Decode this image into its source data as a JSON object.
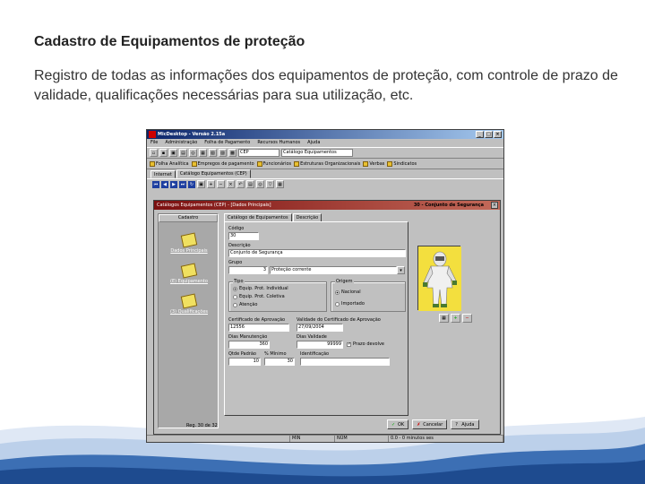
{
  "slide": {
    "title": "Cadastro de Equipamentos de proteção",
    "body": "Registro de todas as informações dos equipamentos de proteção, com controle de prazo de validade, qualificações necessárias para sua utilização, etc."
  },
  "window": {
    "title": "MicDesktop - Versão 2.15a",
    "menu": [
      "File",
      "Administração",
      "Folha de Pagamento",
      "Recursos Humanos",
      "Ajuda"
    ],
    "search_code": "CEP",
    "search_name": "Catálogo Equipamentos",
    "shortcuts": [
      "Folha Analítica",
      "Empregos de pagamento",
      "Funcionários",
      "Estruturas Organizacionais",
      "Verbas",
      "Sindicatos"
    ],
    "doc_tabs": [
      "Internet",
      "Catálogo Equipamentos (CEP)"
    ]
  },
  "child": {
    "title": "Catálogos Equipamentos (CEP) - [Dados Principais]",
    "record_title": "30 - Conjunto de Segurança",
    "left_panel_header": "Cadastro",
    "left_items": [
      "Dados Principais",
      "(E) Equipamento",
      "(3) Qualificações"
    ],
    "tabs": [
      "Catálogo de Equipamentos",
      "Descrição"
    ],
    "fields": {
      "codigo_label": "Código",
      "codigo_value": "30",
      "descricao_label": "Descrição",
      "descricao_value": "Conjunto de Segurança",
      "grupo_label": "Grupo",
      "grupo_num": "3",
      "grupo_value": "Proteção corrente",
      "tipo_label": "Tipo",
      "tipo_options": [
        "Equip. Prot. Individual",
        "Equip. Prot. Coletiva",
        "Atenção"
      ],
      "origem_label": "Origem",
      "origem_options": [
        "Nacional",
        "Importado"
      ],
      "cert_label": "Certificado de Aprovação",
      "cert_value": "12556",
      "validade_label": "Validade do Certificado de Aprovação",
      "validade_value": "27/09/2004",
      "manut_label": "Dias Manutenção",
      "manut_value": "360",
      "dias_validade_label": "Dias Validade",
      "dias_validade_value": "99999",
      "prazo_label": "Prazo devolve",
      "qtde_label": "Qtde Padrão",
      "qtde_value": "10",
      "minimo_label": "% Mínimo",
      "minimo_value": "30",
      "ident_label": "Identificação",
      "ident_value": ""
    },
    "record_counter": "Reg. 30 de 32",
    "buttons": {
      "ok": "OK",
      "cancel": "Cancelar",
      "help": "Ajuda"
    }
  },
  "statusbar": [
    "MIN",
    "NÚM",
    "0.0 - 0 minutos ses"
  ]
}
